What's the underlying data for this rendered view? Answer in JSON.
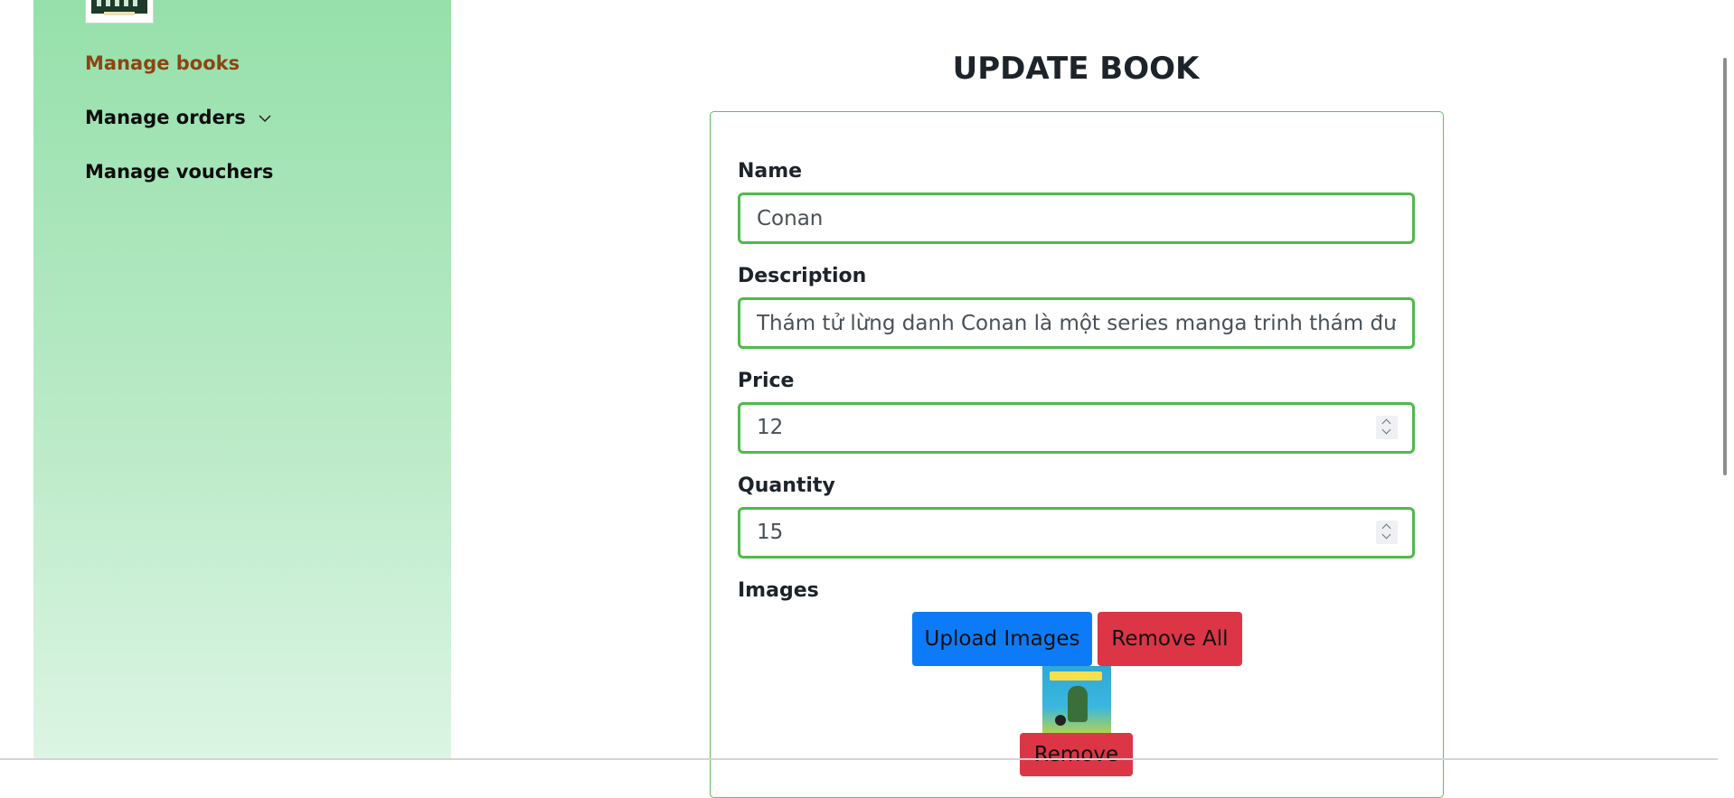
{
  "sidebar": {
    "items": [
      {
        "label": "Manage books"
      },
      {
        "label": "Manage orders"
      },
      {
        "label": "Manage vouchers"
      }
    ]
  },
  "page": {
    "title": "UPDATE BOOK"
  },
  "form": {
    "name": {
      "label": "Name",
      "value": "Conan"
    },
    "description": {
      "label": "Description",
      "value": "Thám tử lừng danh Conan là một series manga trinh thám được s"
    },
    "price": {
      "label": "Price",
      "value": "12"
    },
    "quantity": {
      "label": "Quantity",
      "value": "15"
    },
    "images": {
      "label": "Images"
    }
  },
  "buttons": {
    "upload": "Upload Images",
    "remove_all": "Remove All",
    "remove": "Remove"
  },
  "colors": {
    "sidebar_gradient_top": "#96e0ab",
    "active_nav": "#8b4513",
    "input_border": "#4dbb4a",
    "upload_button": "#0d7bf7",
    "danger_button": "#dc3545"
  }
}
